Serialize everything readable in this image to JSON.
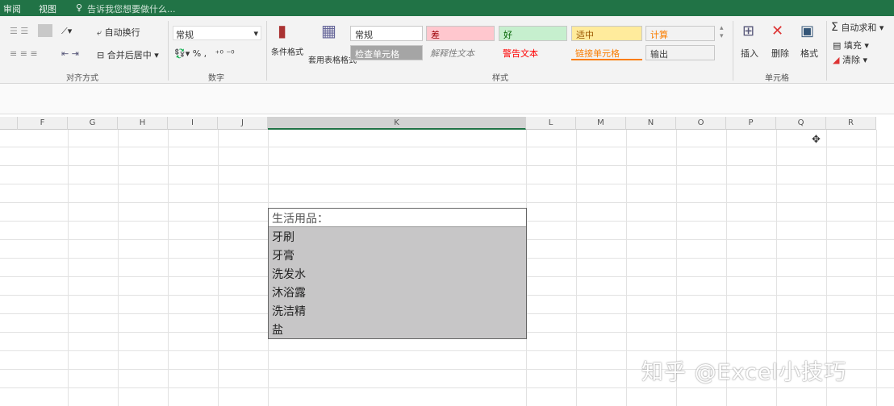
{
  "titlebar": {
    "tabs": [
      "审阅",
      "视图"
    ],
    "tell_me": "告诉我您想要做什么..."
  },
  "ribbon": {
    "alignment": {
      "wrap": "自动换行",
      "merge": "合并后居中",
      "label": "对齐方式"
    },
    "number": {
      "format": "常规",
      "label": "数字"
    },
    "styles": {
      "conditional": "条件格式",
      "table_format": "套用表格格式",
      "items": [
        {
          "text": "常规",
          "bg": "#ffffff",
          "color": "#333333"
        },
        {
          "text": "差",
          "bg": "#ffc7ce",
          "color": "#9c0006"
        },
        {
          "text": "好",
          "bg": "#c6efce",
          "color": "#006100"
        },
        {
          "text": "适中",
          "bg": "#ffeb9c",
          "color": "#9c5700"
        },
        {
          "text": "计算",
          "bg": "#f2f2f2",
          "color": "#fa7d00"
        },
        {
          "text": "检查单元格",
          "bg": "#a5a5a5",
          "color": "#ffffff"
        },
        {
          "text": "解释性文本",
          "bg": "#f3f3f3",
          "color": "#7f7f7f"
        },
        {
          "text": "警告文本",
          "bg": "#f3f3f3",
          "color": "#ff0000"
        },
        {
          "text": "链接单元格",
          "bg": "#f3f3f3",
          "color": "#fa7d00"
        },
        {
          "text": "输出",
          "bg": "#f2f2f2",
          "color": "#3f3f3f"
        }
      ],
      "label": "样式"
    },
    "cells": {
      "insert": "插入",
      "delete": "删除",
      "format": "格式",
      "label": "单元格"
    },
    "editing": {
      "autosum": "自动求和",
      "fill": "填充",
      "clear": "清除"
    }
  },
  "columns": [
    "F",
    "G",
    "H",
    "I",
    "J",
    "K",
    "L",
    "M",
    "N",
    "O",
    "P",
    "Q",
    "R"
  ],
  "selected_column": "K",
  "cell_list": {
    "header": "生活用品：",
    "items": [
      "牙刷",
      "牙膏",
      "洗发水",
      "沐浴露",
      "洗洁精",
      "盐"
    ]
  },
  "watermark": "知乎 @Excel小技巧",
  "colors": {
    "accent": "#217346",
    "selection": "#c7c6c7"
  }
}
